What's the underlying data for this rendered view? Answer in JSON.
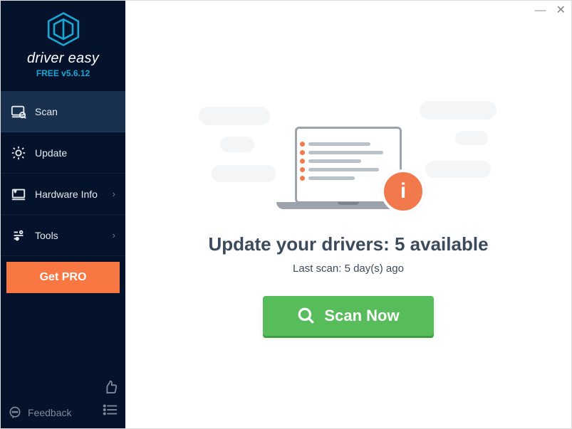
{
  "brand": {
    "name": "driver easy",
    "sub": "FREE v5.6.12"
  },
  "nav": {
    "scan": {
      "label": "Scan"
    },
    "update": {
      "label": "Update"
    },
    "hw": {
      "label": "Hardware Info"
    },
    "tools": {
      "label": "Tools"
    }
  },
  "get_pro_label": "Get PRO",
  "feedback_label": "Feedback",
  "main": {
    "headline_prefix": "Update your drivers: ",
    "headline_count": "5",
    "headline_suffix": " available",
    "last_scan": "Last scan: 5 day(s) ago",
    "scan_button": "Scan Now",
    "info_badge": "i"
  },
  "colors": {
    "accent": "#f97743",
    "scan": "#56bd5a",
    "sidebar": "#04132b"
  }
}
